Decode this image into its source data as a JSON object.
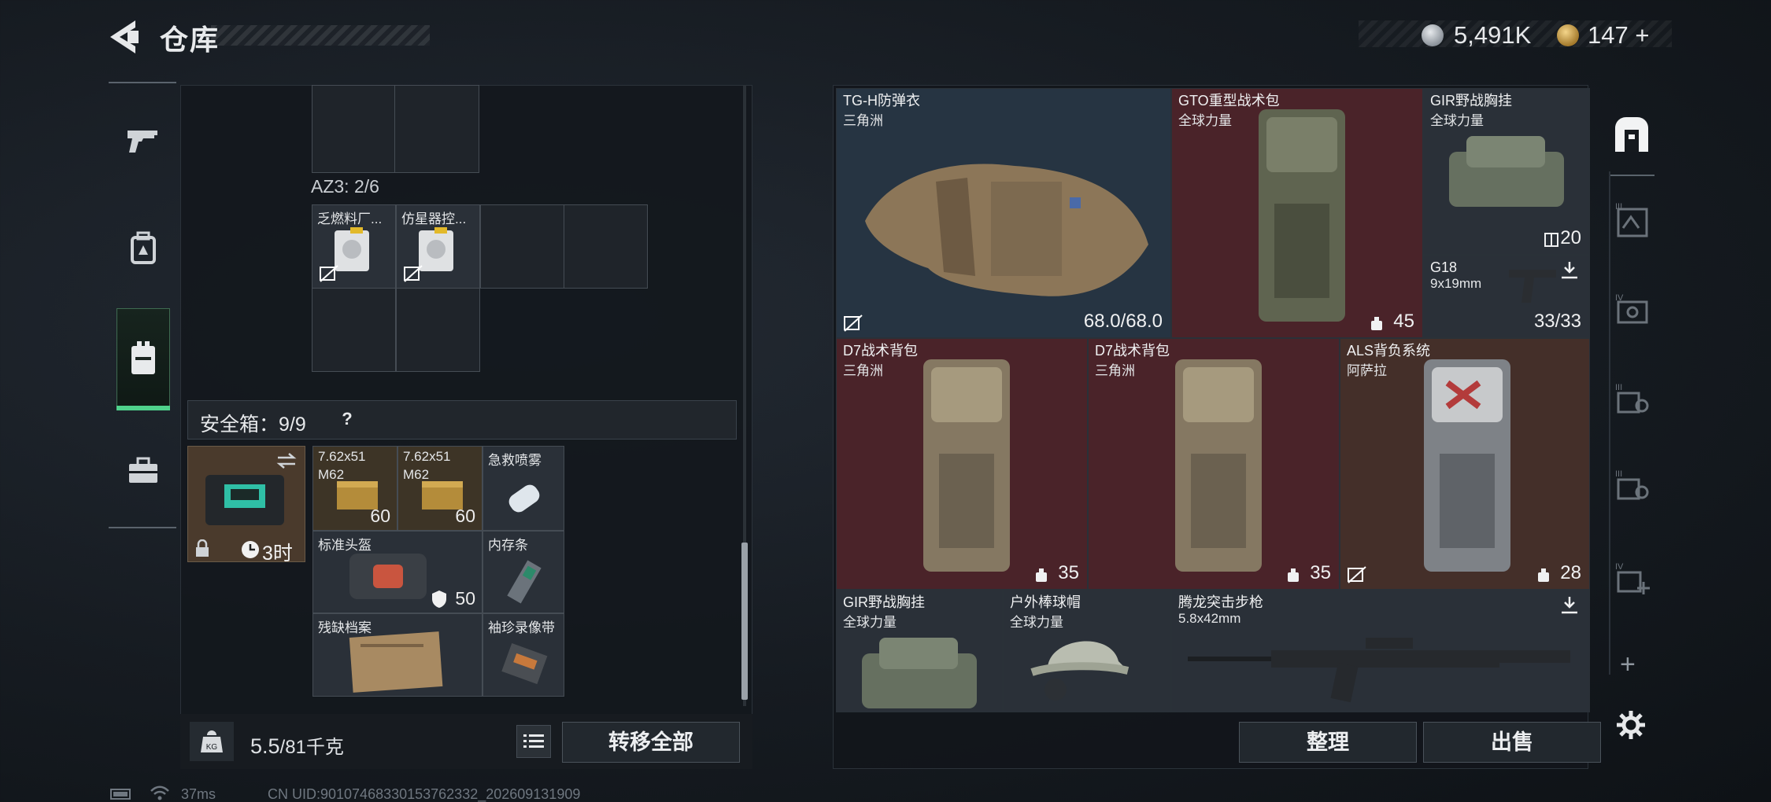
{
  "header": {
    "title": "仓库",
    "currency_silver": "5,491K",
    "currency_gold": "147",
    "gold_plus": "+"
  },
  "left_nav": {
    "items": [
      {
        "icon": "pistol-icon"
      },
      {
        "icon": "backpack-icon"
      },
      {
        "icon": "vest-icon",
        "active": true
      },
      {
        "icon": "case-icon"
      }
    ],
    "active_color": "#4fd18b"
  },
  "container": {
    "az_label": "AZ3: 2/6",
    "items": [
      {
        "name": "乏燃料厂..."
      },
      {
        "name": "仿星器控..."
      }
    ]
  },
  "safe_box": {
    "title": "安全箱：9/9",
    "help": "?",
    "timer": "3时",
    "items": [
      {
        "name": "7.62x51",
        "sub": "M62",
        "qty": "60"
      },
      {
        "name": "7.62x51",
        "sub": "M62",
        "qty": "60"
      },
      {
        "name": "急救喷雾"
      },
      {
        "name": "标准头盔",
        "qty": "50"
      },
      {
        "name": "内存条"
      },
      {
        "name": "残缺档案"
      },
      {
        "name": "袖珍录像带"
      }
    ]
  },
  "footer_left": {
    "weight": "5.5",
    "weight_max": "/81千克",
    "kg_label": "KG",
    "transfer_all": "转移全部"
  },
  "stash": {
    "slots": [
      {
        "name": "TG-H防弹衣",
        "sub": "三角洲",
        "value": "68.0/68.0",
        "color": "blue"
      },
      {
        "name": "GTO重型战术包",
        "sub": "全球力量",
        "value": "45",
        "color": "red"
      },
      {
        "name": "GIR野战胸挂",
        "sub": "全球力量",
        "value": "20",
        "color": "grey"
      },
      {
        "name": "G18",
        "sub": "9x19mm",
        "value": "33/33",
        "color": "grey"
      },
      {
        "name": "D7战术背包",
        "sub": "三角洲",
        "value": "35",
        "color": "red"
      },
      {
        "name": "D7战术背包",
        "sub": "三角洲",
        "value": "35",
        "color": "red"
      },
      {
        "name": "ALS背负系统",
        "sub": "阿萨拉",
        "value": "28",
        "color": "brown"
      },
      {
        "name": "GIR野战胸挂",
        "sub": "全球力量",
        "color": "grey"
      },
      {
        "name": "户外棒球帽",
        "sub": "全球力量",
        "color": "grey"
      },
      {
        "name": "腾龙突击步枪",
        "sub": "5.8x42mm",
        "color": "grey"
      }
    ],
    "colors": {
      "blue": "#263442",
      "red": "#4a2329",
      "brown": "#442f29",
      "grey": "#2a3038"
    }
  },
  "footer_right": {
    "sort": "整理",
    "sell": "出售"
  },
  "right_rail": {
    "items": [
      {
        "icon": "stash-home-icon",
        "active": true
      },
      {
        "icon": "stash-page-3-icon",
        "label": "III"
      },
      {
        "icon": "stash-page-4-icon",
        "label": "IV"
      },
      {
        "icon": "stash-page-3b-icon",
        "label": "III"
      },
      {
        "icon": "stash-page-3c-icon",
        "label": "III"
      },
      {
        "icon": "stash-page-4-add-icon",
        "label": "IV"
      }
    ],
    "add": "+"
  },
  "status": {
    "ping": "37ms",
    "uid": "CN UID:90107468330153762332_202609131909"
  }
}
